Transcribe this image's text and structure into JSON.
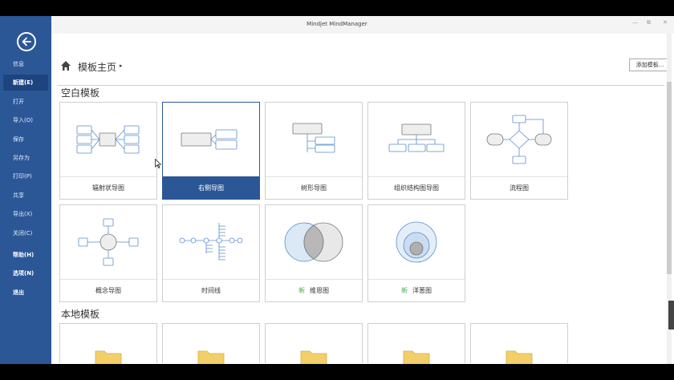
{
  "window": {
    "title": "Mindjet MindManager",
    "min": "—",
    "restore": "⧉",
    "close": "✕"
  },
  "sidebar": {
    "items": [
      {
        "label": "信息"
      },
      {
        "label": "新建(E)"
      },
      {
        "label": "打开"
      },
      {
        "label": "导入(O)"
      },
      {
        "label": "保存"
      },
      {
        "label": "另存为"
      },
      {
        "label": "打印(P)"
      },
      {
        "label": "共享"
      },
      {
        "label": "导出(X)"
      },
      {
        "label": "关闭(C)"
      },
      {
        "label": "帮助(H)"
      },
      {
        "label": "选项(N)"
      },
      {
        "label": "退出"
      }
    ]
  },
  "header": {
    "breadcrumb": "模板主页",
    "breadcrumb_arrow": "▸",
    "add_template": "添加模板..."
  },
  "sections": {
    "blank": "空白模板",
    "local": "本地模板"
  },
  "blank_templates": [
    {
      "label": "辐射状导图"
    },
    {
      "label": "右侧导图"
    },
    {
      "label": "树形导图"
    },
    {
      "label": "组织结构图导图"
    },
    {
      "label": "流程图"
    },
    {
      "label": "概念导图"
    },
    {
      "label": "时间线"
    },
    {
      "label": "维恩图",
      "tag": "新"
    },
    {
      "label": "洋葱图",
      "tag": "新"
    }
  ],
  "colors": {
    "accent": "#2b5797",
    "new_tag": "#4caa4c",
    "diagram_stroke": "#5b8dc9",
    "folder": "#f3cf6a"
  }
}
